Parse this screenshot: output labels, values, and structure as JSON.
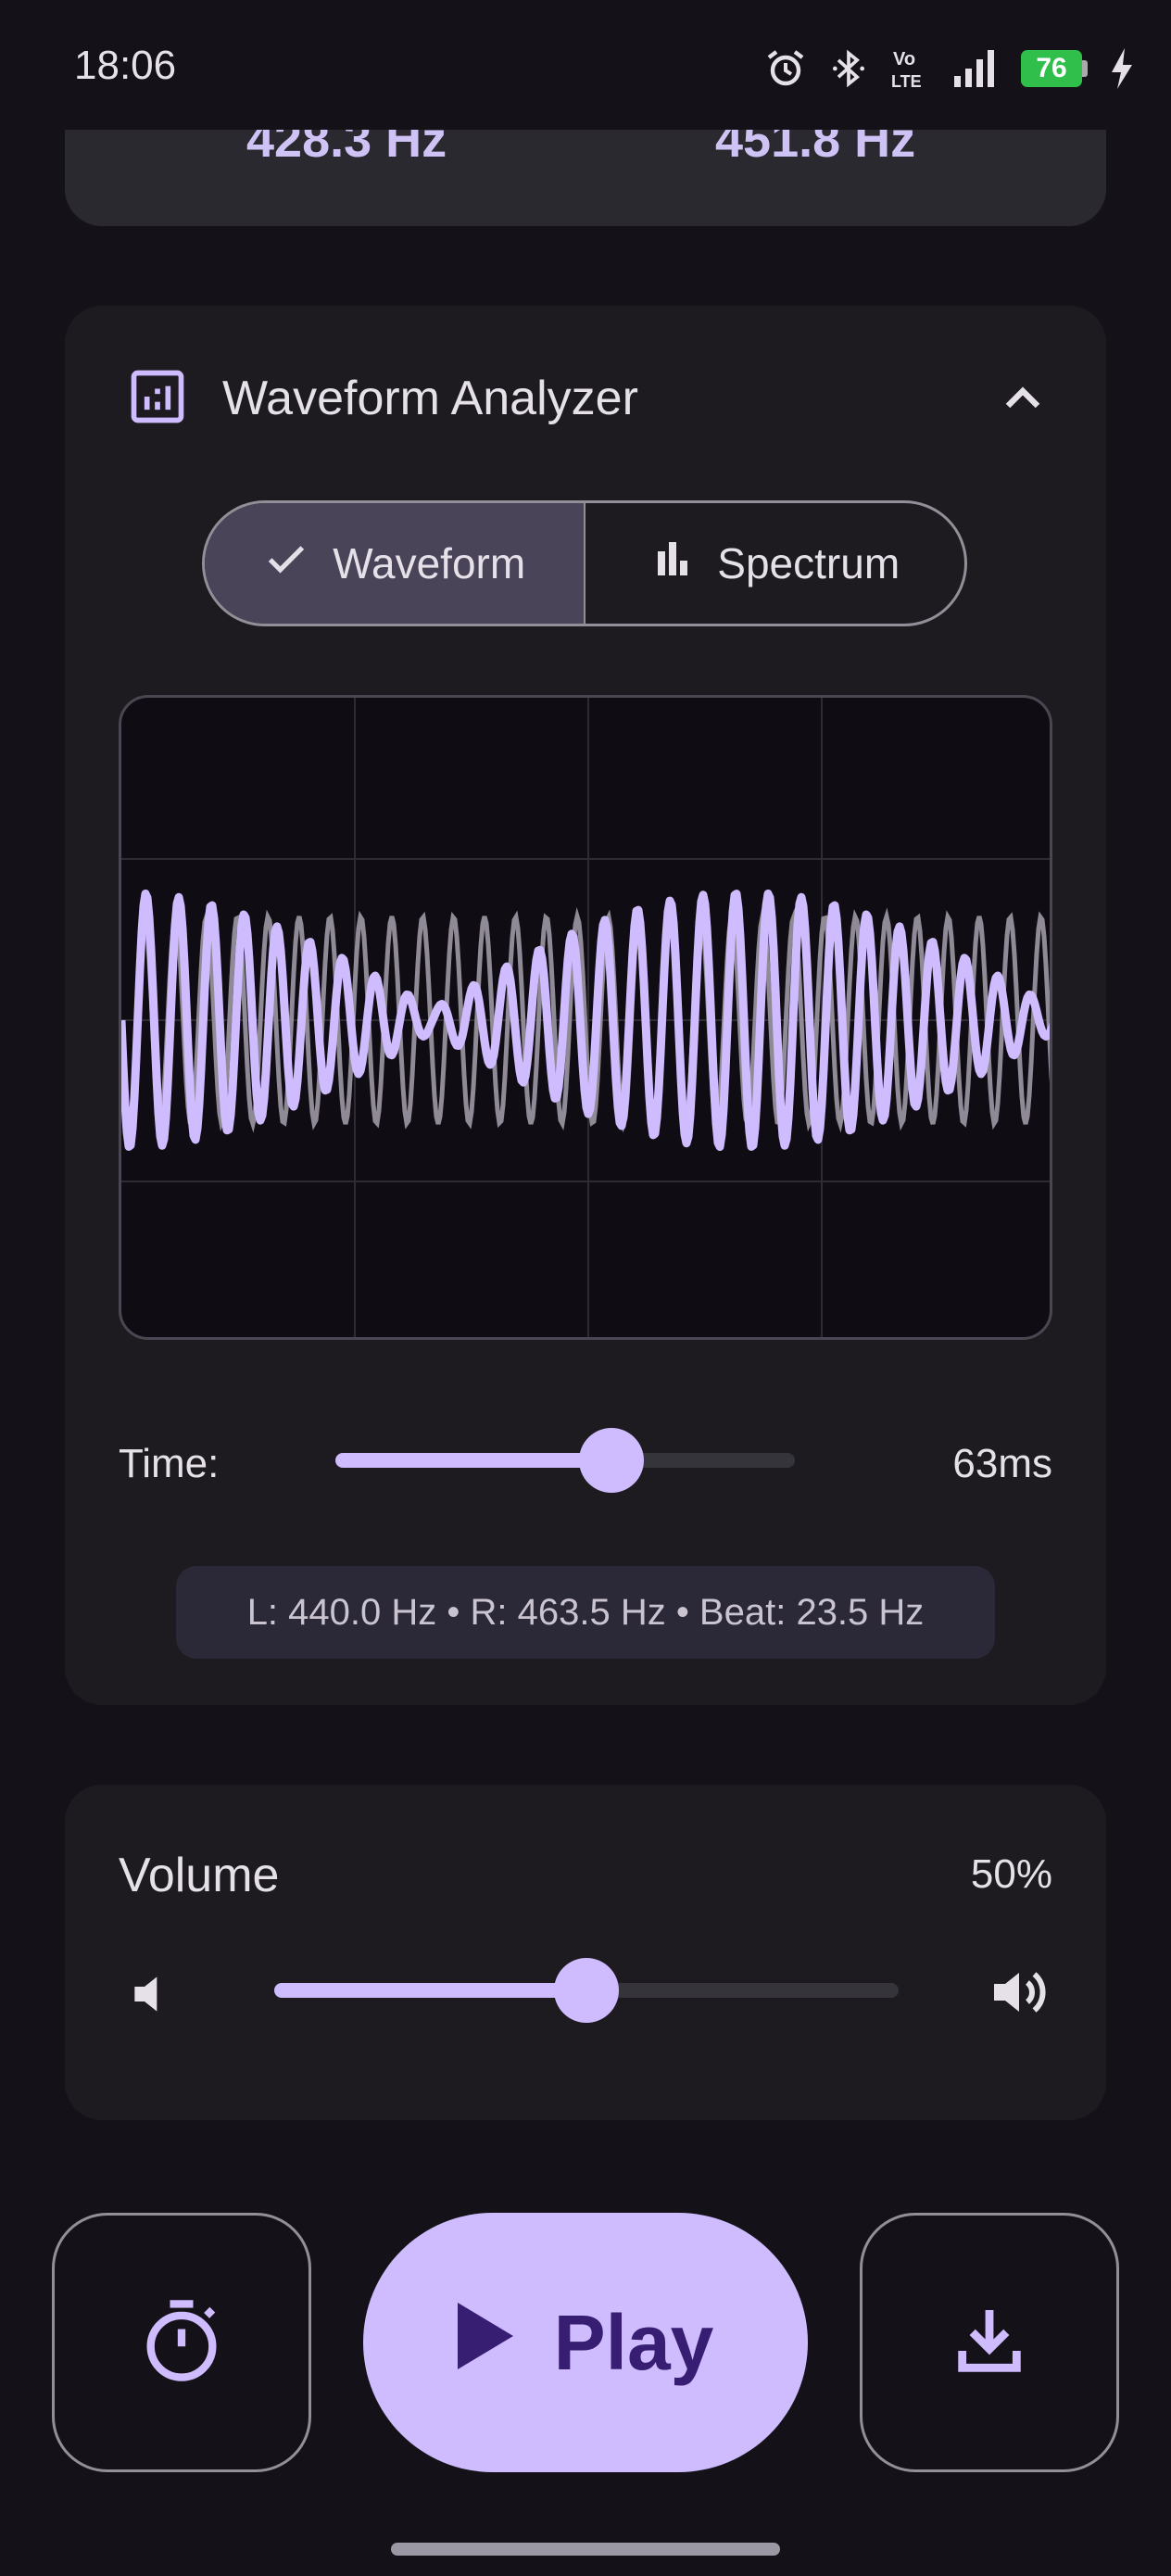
{
  "status_bar": {
    "time": "18:06",
    "battery": "76"
  },
  "top_card": {
    "left_freq": "428.3 Hz",
    "right_freq": "451.8 Hz"
  },
  "analyzer": {
    "title": "Waveform Analyzer",
    "tabs": [
      {
        "label": "Waveform",
        "selected": true
      },
      {
        "label": "Spectrum",
        "selected": false
      }
    ],
    "time_label": "Time:",
    "time_value": "63ms",
    "time_slider_fraction": 0.6,
    "info": "L: 440.0 Hz • R: 463.5 Hz • Beat: 23.5 Hz"
  },
  "volume": {
    "label": "Volume",
    "value": "50%",
    "fraction": 0.5
  },
  "actions": {
    "play_label": "Play"
  },
  "colors": {
    "accent": "#cfbcff",
    "background": "#141218",
    "card": "#1d1b20"
  },
  "icons": [
    "alarm-icon",
    "bluetooth-icon",
    "volte-icon",
    "signal-icon",
    "battery-icon",
    "charging-icon",
    "analyzer-icon",
    "chevron-up-icon",
    "check-icon",
    "bar-chart-icon",
    "volume-down-icon",
    "volume-up-icon",
    "timer-icon",
    "play-icon",
    "download-icon"
  ]
}
